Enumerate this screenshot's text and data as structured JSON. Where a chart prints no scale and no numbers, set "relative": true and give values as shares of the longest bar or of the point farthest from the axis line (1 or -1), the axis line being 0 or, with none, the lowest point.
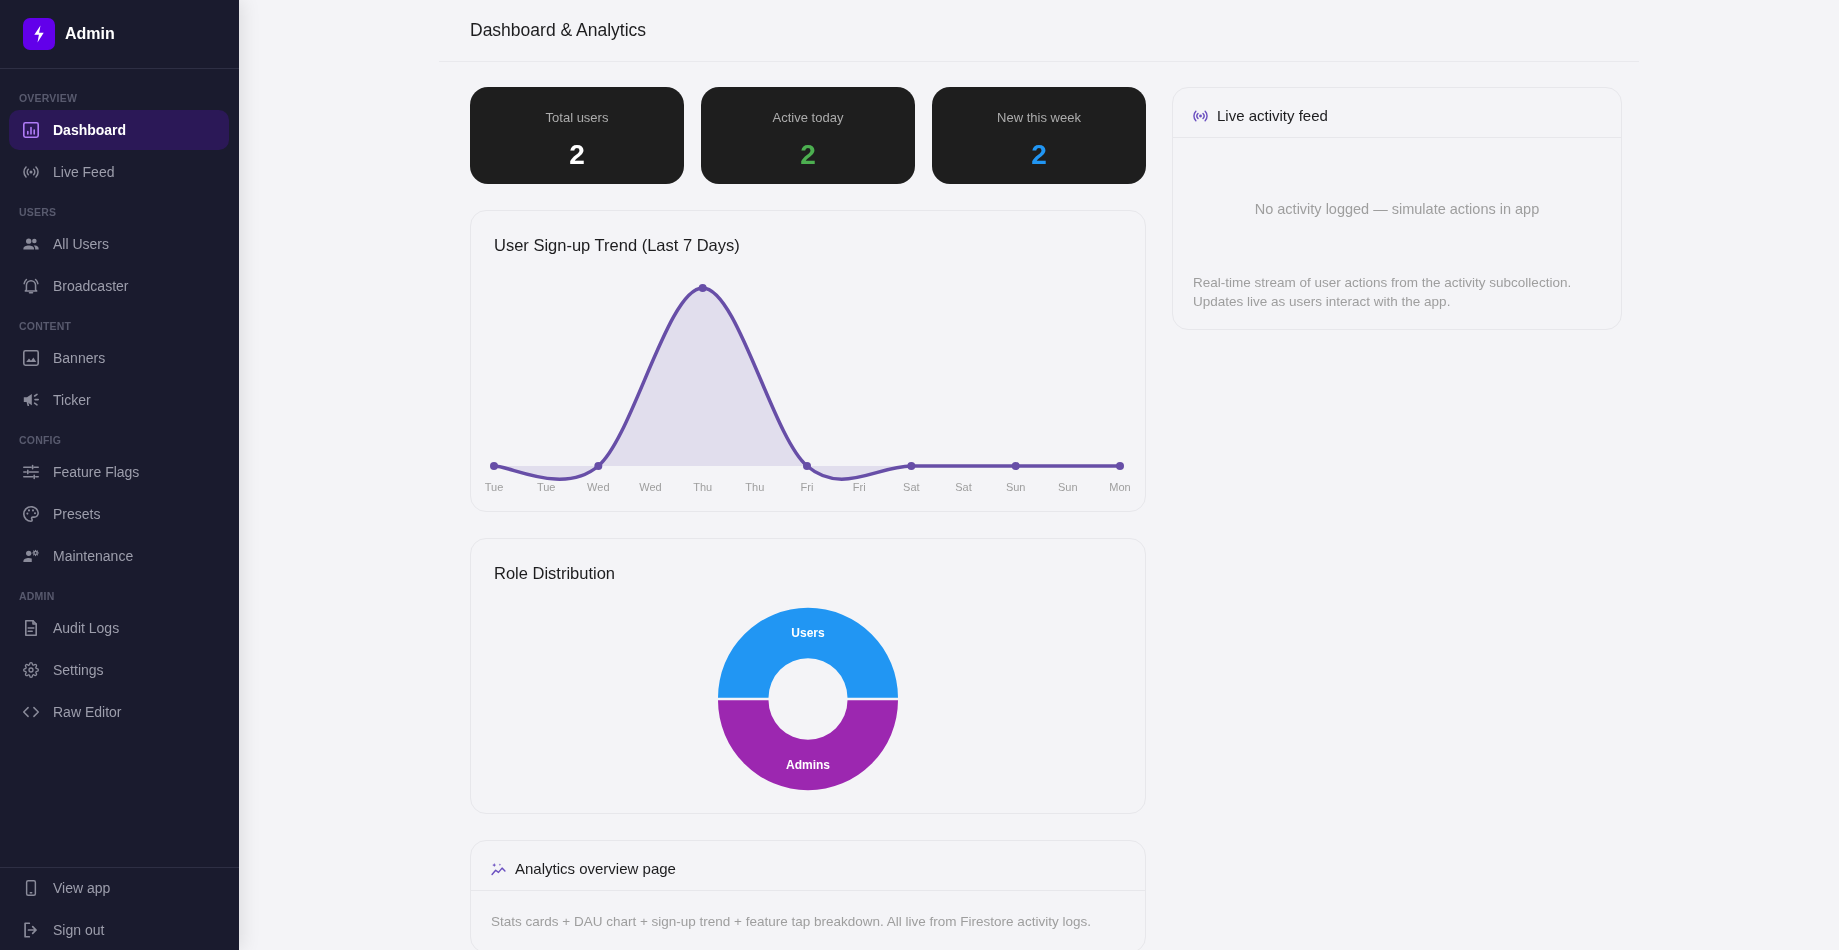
{
  "sidebar": {
    "brand": "Admin",
    "sections": [
      {
        "label": "OVERVIEW",
        "items": [
          {
            "label": "Dashboard",
            "selected": true
          },
          {
            "label": "Live Feed",
            "selected": false
          }
        ]
      },
      {
        "label": "USERS",
        "items": [
          {
            "label": "All Users",
            "selected": false
          },
          {
            "label": "Broadcaster",
            "selected": false
          }
        ]
      },
      {
        "label": "CONTENT",
        "items": [
          {
            "label": "Banners",
            "selected": false
          },
          {
            "label": "Ticker",
            "selected": false
          }
        ]
      },
      {
        "label": "CONFIG",
        "items": [
          {
            "label": "Feature Flags",
            "selected": false
          },
          {
            "label": "Presets",
            "selected": false
          },
          {
            "label": "Maintenance",
            "selected": false
          }
        ]
      },
      {
        "label": "ADMIN",
        "items": [
          {
            "label": "Audit Logs",
            "selected": false
          },
          {
            "label": "Settings",
            "selected": false
          },
          {
            "label": "Raw Editor",
            "selected": false
          }
        ]
      }
    ],
    "footer": [
      {
        "label": "View app"
      },
      {
        "label": "Sign out"
      }
    ]
  },
  "header": {
    "title": "Dashboard & Analytics"
  },
  "stats": [
    {
      "label": "Total users",
      "value": "2",
      "color": "#ffffff"
    },
    {
      "label": "Active today",
      "value": "2",
      "color": "#4caf50"
    },
    {
      "label": "New this week",
      "value": "2",
      "color": "#2196f3"
    }
  ],
  "signup_trend": {
    "title": "User Sign-up Trend (Last 7 Days)",
    "chart_data": {
      "type": "area",
      "relative": true,
      "categories": [
        "Tue",
        "Tue",
        "Wed",
        "Wed",
        "Thu",
        "Thu",
        "Fri",
        "Fri",
        "Sat",
        "Sat",
        "Sun",
        "Sun",
        "Mon"
      ],
      "series": [
        {
          "color": "#674ea7",
          "values": [
            0,
            null,
            0,
            null,
            1,
            null,
            0,
            null,
            0,
            null,
            0,
            null,
            0
          ]
        }
      ]
    }
  },
  "role_distribution": {
    "title": "Role Distribution",
    "chart_data": {
      "type": "donut",
      "categories": [
        "Users",
        "Admins"
      ],
      "values": [
        50,
        50
      ],
      "colors": [
        "#2196f3",
        "#9c27b0"
      ]
    }
  },
  "overview_note": {
    "title": "Analytics overview page",
    "text": "Stats cards + DAU chart + sign-up trend + feature tap breakdown. All live from Firestore activity logs."
  },
  "live_feed": {
    "title": "Live activity feed",
    "empty_message": "No activity logged — simulate actions in app",
    "description": "Real-time stream of user actions from the activity subcollection. Updates live as users interact with the app."
  }
}
